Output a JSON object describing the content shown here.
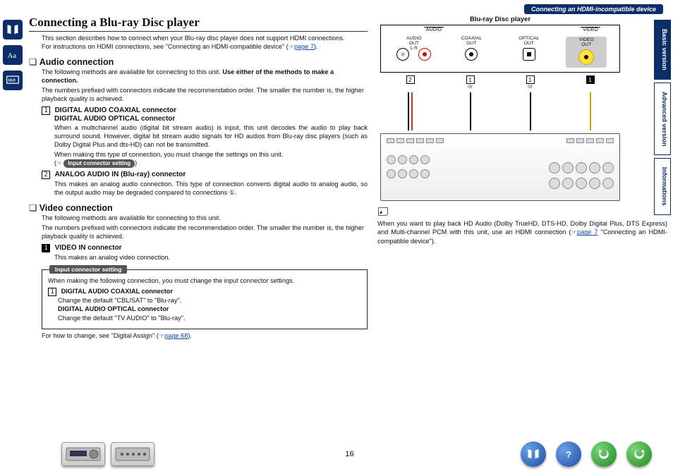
{
  "header": {
    "breadcrumb": "Connecting an HDMI-incompatible device"
  },
  "sideTabs": {
    "basic": "Basic version",
    "advanced": "Advanced version",
    "info": "Informations"
  },
  "title": "Connecting a Blu-ray Disc player",
  "intro": {
    "line1": "This section describes how to connect when your Blu-ray disc player does not support HDMI connections.",
    "line2a": "For instructions on HDMI connections, see \"Connecting an HDMI-compatible device\" (",
    "link": "page 7",
    "line2b": ")."
  },
  "audio": {
    "heading": "Audio connection",
    "p1a": "The following methods are available for connecting to this unit. ",
    "p1b": "Use either of the methods to make a connection.",
    "p2": "The numbers prefixed with connectors indicate the recommendation order. The smaller the number is, the higher playback quality is achieved.",
    "item1": {
      "num": "1",
      "title1": "DIGITAL AUDIO COAXIAL connector",
      "title2": "DIGITAL AUDIO OPTICAL connector",
      "body": "When a multichannel audio (digital bit stream audio) is input, this unit decodes the audio to play back surround sound. However, digital bit stream audio signals for HD audios from Blu-ray disc players (such as Dolby Digital Plus and dts-HD) can not be transmitted.",
      "body2": "When making this type of connection, you must change the settings on this unit.",
      "see": "(",
      "pill": "Input connector setting",
      "see2": ")"
    },
    "item2": {
      "num": "2",
      "title": "ANALOG AUDIO IN (Blu-ray) connector",
      "body": "This makes an analog audio connection. This type of connection converts digital audio to analog audio, so the output audio may be degraded compared to connections ①."
    }
  },
  "video": {
    "heading": "Video connection",
    "p1": "The following methods are available for connecting to this unit.",
    "p2": "The numbers prefixed with connectors indicate the recommendation order. The smaller the number is, the higher playback quality is achieved.",
    "item1": {
      "num": "1",
      "title": "VIDEO IN connector",
      "body": "This makes an analog video connection."
    }
  },
  "box": {
    "title": "Input connector setting",
    "lead": "When making the following connection, you must change the input connector settings.",
    "row1num": "1",
    "row1title": "DIGITAL AUDIO COAXIAL connector",
    "row1body": "Change the default \"CBL/SAT\" to \"Blu-ray\".",
    "row2title": "DIGITAL AUDIO OPTICAL connector",
    "row2body": "Change the default \"TV AUDIO\" to \"Blu-ray\".",
    "foot1": "For how to change, see \"Digital Assign\" (",
    "footlink": "page 68",
    "foot2": ")."
  },
  "note": {
    "text1": "When you want to play back HD Audio (Dolby TrueHD, DTS-HD, Dolby Digital Plus, DTS Express) and Multi-channel PCM with this unit, use an HDMI connection (",
    "link": "page 7",
    "text2": " \"Connecting an HDMI-compatible device\")."
  },
  "diagram": {
    "title": "Blu-ray Disc player",
    "audioGroup": "AUDIO",
    "videoGroup": "VIDEO",
    "ports": {
      "analog": "AUDIO\nOUT",
      "analogLR": "L    R",
      "coax": "COAXIAL\nOUT",
      "optical": "OPTICAL\nOUT",
      "video": "VIDEO\nOUT"
    },
    "nums": {
      "analog": "2",
      "coax": "1",
      "optical": "1",
      "video": "1"
    },
    "or": "or"
  },
  "footer": {
    "page": "16"
  }
}
